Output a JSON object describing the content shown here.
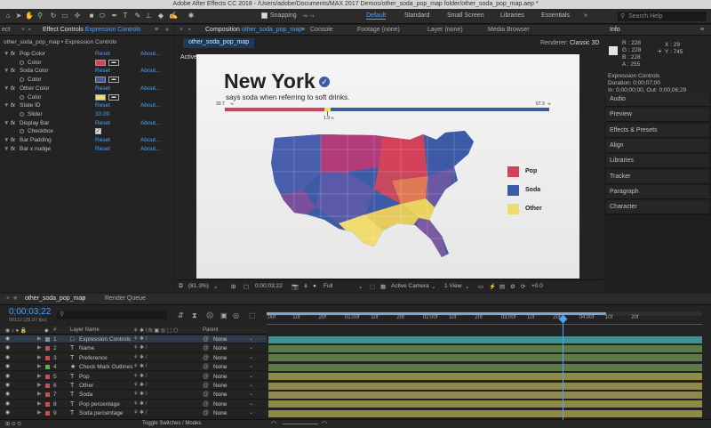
{
  "window_title": "Adobe After Effects CC 2018 - /Users/adobe/Documents/MAX 2017 Demos/other_soda_pop_map folder/other_soda_pop_map.aep *",
  "toolbar": {
    "snapping_label": "Snapping",
    "workspaces": [
      "Default",
      "Standard",
      "Small Screen",
      "Libraries",
      "Essentials"
    ],
    "active_workspace": "Default",
    "search_placeholder": "Search Help"
  },
  "effect_controls": {
    "tab_prefix": "Effect Controls",
    "tab_name": "Expression Controls",
    "breadcrumb": "other_soda_pop_map • Expression Controls",
    "rows": [
      {
        "type": "effect",
        "name": "Pop Color",
        "reset": "Reset",
        "about": "About..."
      },
      {
        "type": "color",
        "name": "Color",
        "color": "#d4415b"
      },
      {
        "type": "effect",
        "name": "Soda Color",
        "reset": "Reset",
        "about": "About..."
      },
      {
        "type": "color",
        "name": "Color",
        "color": "#3d5aa6"
      },
      {
        "type": "effect",
        "name": "Other Color",
        "reset": "Reset",
        "about": "About..."
      },
      {
        "type": "color",
        "name": "Color",
        "color": "#f0dc6e"
      },
      {
        "type": "effect",
        "name": "State ID",
        "reset": "Reset",
        "about": "About..."
      },
      {
        "type": "value",
        "name": "Slider",
        "value": "33.00"
      },
      {
        "type": "effect",
        "name": "Display Bar",
        "reset": "Reset",
        "about": "About..."
      },
      {
        "type": "check",
        "name": "Checkbox"
      },
      {
        "type": "effect",
        "name": "Bar Padding",
        "reset": "Reset",
        "about": "About..."
      },
      {
        "type": "effect",
        "name": "Bar x nudge",
        "reset": "Reset",
        "about": "About..."
      }
    ]
  },
  "center_tabs": {
    "composition_prefix": "Composition",
    "composition_name": "other_soda_pop_map",
    "console": "Console",
    "footage": "Footage (none)",
    "layer": "Layer (none)",
    "media_browser": "Media Browser",
    "comp_subtab": "other_soda_pop_map",
    "renderer": "Renderer:",
    "renderer_value": "Classic 3D",
    "active_camera": "Active Camera"
  },
  "composition": {
    "state_name": "New York",
    "subtitle": "says soda when referring to soft drinks.",
    "pop_pct": "30.7",
    "other_pct": "1.9",
    "soda_pct": "67.3",
    "legend": [
      {
        "label": "Pop",
        "color": "#d4415b"
      },
      {
        "label": "Soda",
        "color": "#3d5aa6"
      },
      {
        "label": "Other",
        "color": "#f0dc6e"
      }
    ]
  },
  "viewer_bar": {
    "zoom": "(81.3%)",
    "timecode": "0;00;03;22",
    "resolution": "Full",
    "view": "Active Camera",
    "views": "1 View",
    "exposure": "+0.0"
  },
  "info_panel": {
    "title": "Info",
    "r": "R : 228",
    "g": "G : 228",
    "b": "B : 228",
    "a": "A : 255",
    "x": "X : 29",
    "y": "Y : 745",
    "layer_name": "Expression Controls",
    "duration": "Duration: 0;00;07;00",
    "in_out": "In: 0;00;00;00, Out: 0;00;06;29"
  },
  "side_panels": [
    "Audio",
    "Preview",
    "Effects & Presets",
    "Align",
    "Libraries",
    "Tracker",
    "Paragraph",
    "Character"
  ],
  "timeline": {
    "comp_tab": "other_soda_pop_map",
    "render_queue": "Render Queue",
    "current_time": "0;00;03;22",
    "frames": "00112 (29.97 fps)",
    "search_placeholder": "",
    "col_layer_name": "Layer Name",
    "col_parent": "Parent",
    "toggle_label": "Toggle Switches / Modes",
    "ruler": [
      ":00f",
      "10f",
      "20f",
      "01:00f",
      "10f",
      "20f",
      "02:00f",
      "10f",
      "20f",
      "03:00f",
      "10f",
      "20f",
      "04:00f",
      "10f",
      "20f"
    ],
    "layers": [
      {
        "num": "1",
        "type": "□",
        "name": "Expression Controls",
        "label": "#8c8c8c",
        "parent": "None",
        "bar": "#3f8f94"
      },
      {
        "num": "2",
        "type": "T",
        "name": "Name",
        "label": "#c45050",
        "parent": "None",
        "bar": "#5b7a45"
      },
      {
        "num": "3",
        "type": "T",
        "name": "Preference",
        "label": "#c45050",
        "parent": "None",
        "bar": "#5b7a45"
      },
      {
        "num": "4",
        "type": "★",
        "name": "Check Mark Outlines",
        "label": "#6aa84f",
        "parent": "None",
        "bar": "#5b7a45"
      },
      {
        "num": "5",
        "type": "T",
        "name": "Pop",
        "label": "#c45050",
        "parent": "None",
        "bar": "#8f8a48"
      },
      {
        "num": "6",
        "type": "T",
        "name": "Other",
        "label": "#c45050",
        "parent": "None",
        "bar": "#8f8a48"
      },
      {
        "num": "7",
        "type": "T",
        "name": "Soda",
        "label": "#c45050",
        "parent": "None",
        "bar": "#8f8a48"
      },
      {
        "num": "8",
        "type": "T",
        "name": "Pop percentage",
        "label": "#c45050",
        "parent": "None",
        "bar": "#8f8a48"
      },
      {
        "num": "9",
        "type": "T",
        "name": "Soda percentage",
        "label": "#c45050",
        "parent": "None",
        "bar": "#8f8a48"
      }
    ]
  }
}
